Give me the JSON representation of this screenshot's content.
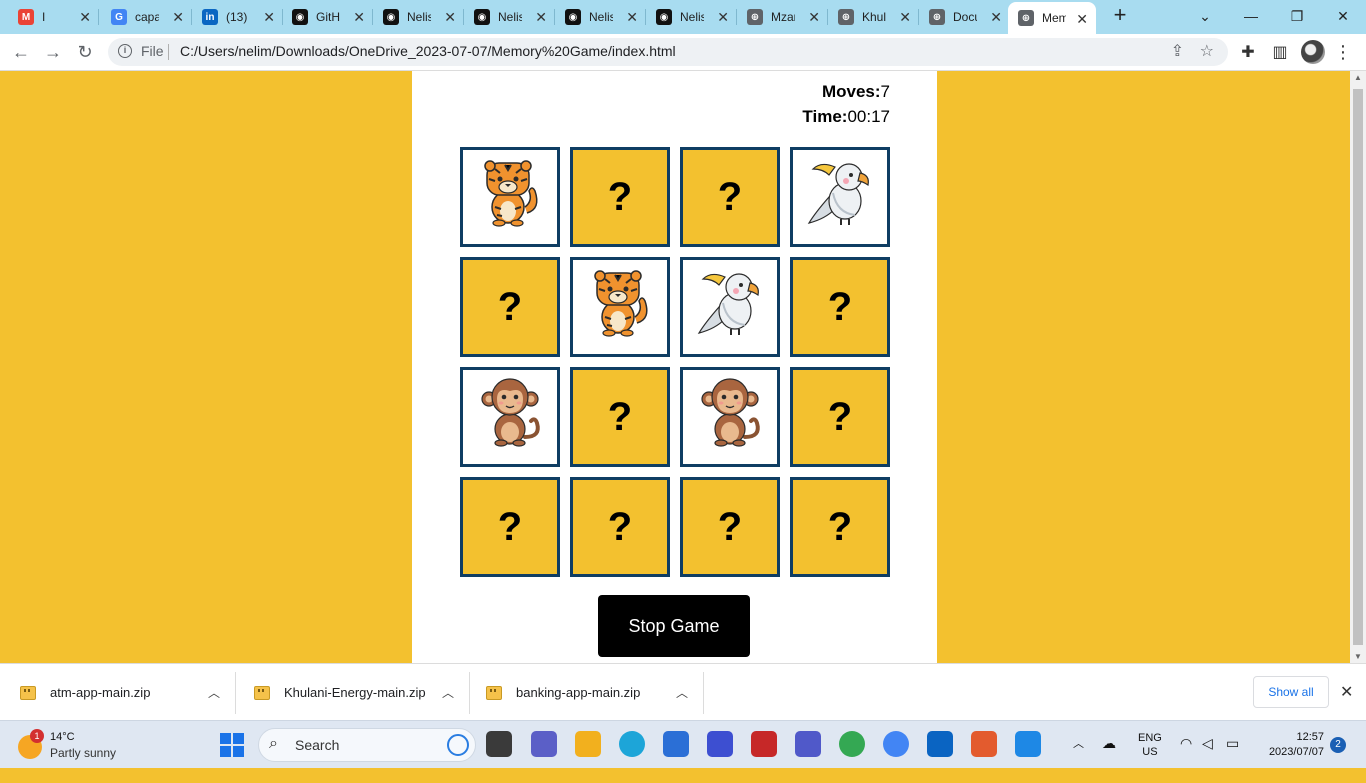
{
  "browser": {
    "tabs": [
      {
        "label": "I",
        "icon": "gmail-icon",
        "color": "#ea4335",
        "glyph": "M"
      },
      {
        "label": "capa",
        "icon": "google-icon",
        "color": "#4285f4",
        "glyph": "G"
      },
      {
        "label": "(13) ",
        "icon": "linkedin-icon",
        "color": "#0a66c2",
        "glyph": "in"
      },
      {
        "label": "GitH",
        "icon": "github-icon",
        "color": "#111111",
        "glyph": "◉"
      },
      {
        "label": "Nelis",
        "icon": "github-icon",
        "color": "#111111",
        "glyph": "◉"
      },
      {
        "label": "Nelis",
        "icon": "github-icon",
        "color": "#111111",
        "glyph": "◉"
      },
      {
        "label": "Nelis",
        "icon": "github-icon",
        "color": "#111111",
        "glyph": "◉"
      },
      {
        "label": "Nelis",
        "icon": "github-icon",
        "color": "#111111",
        "glyph": "◉"
      },
      {
        "label": "Mzar",
        "icon": "globe-icon",
        "color": "#5f6368",
        "glyph": "⊕"
      },
      {
        "label": "Khula",
        "icon": "globe-icon",
        "color": "#5f6368",
        "glyph": "⊕"
      },
      {
        "label": "Docu",
        "icon": "globe-icon",
        "color": "#5f6368",
        "glyph": "⊕"
      },
      {
        "label": "Mem",
        "icon": "globe-icon",
        "color": "#5f6368",
        "glyph": "⊕",
        "active": true
      }
    ],
    "address": {
      "scheme_label": "File",
      "url": "C:/Users/nelim/Downloads/OneDrive_2023-07-07/Memory%20Game/index.html"
    }
  },
  "game": {
    "moves_label": "Moves:",
    "moves_value": "7",
    "time_label": "Time:",
    "time_value": "00:17",
    "hidden_symbol": "?",
    "cards": [
      {
        "state": "open",
        "animal": "tiger"
      },
      {
        "state": "hidden",
        "animal": ""
      },
      {
        "state": "hidden",
        "animal": ""
      },
      {
        "state": "open",
        "animal": "cockatoo"
      },
      {
        "state": "hidden",
        "animal": ""
      },
      {
        "state": "open",
        "animal": "tiger"
      },
      {
        "state": "open",
        "animal": "cockatoo"
      },
      {
        "state": "hidden",
        "animal": ""
      },
      {
        "state": "open",
        "animal": "monkey"
      },
      {
        "state": "hidden",
        "animal": ""
      },
      {
        "state": "open",
        "animal": "monkey"
      },
      {
        "state": "hidden",
        "animal": ""
      },
      {
        "state": "hidden",
        "animal": ""
      },
      {
        "state": "hidden",
        "animal": ""
      },
      {
        "state": "hidden",
        "animal": ""
      },
      {
        "state": "hidden",
        "animal": ""
      }
    ],
    "stop_button_label": "Stop Game",
    "colors": {
      "background": "#f3c12f",
      "card_border": "#0f3d63",
      "panel": "#ffffff"
    }
  },
  "downloads": {
    "items": [
      {
        "name": "atm-app-main.zip"
      },
      {
        "name": "Khulani-Energy-main.zip"
      },
      {
        "name": "banking-app-main.zip"
      }
    ],
    "show_all_label": "Show all"
  },
  "taskbar": {
    "weather_temp": "14°C",
    "weather_condition": "Partly sunny",
    "weather_badge": "1",
    "search_label": "Search",
    "language_line1": "ENG",
    "language_line2": "US",
    "time": "12:57",
    "date": "2023/07/07",
    "notification_count": "2"
  }
}
